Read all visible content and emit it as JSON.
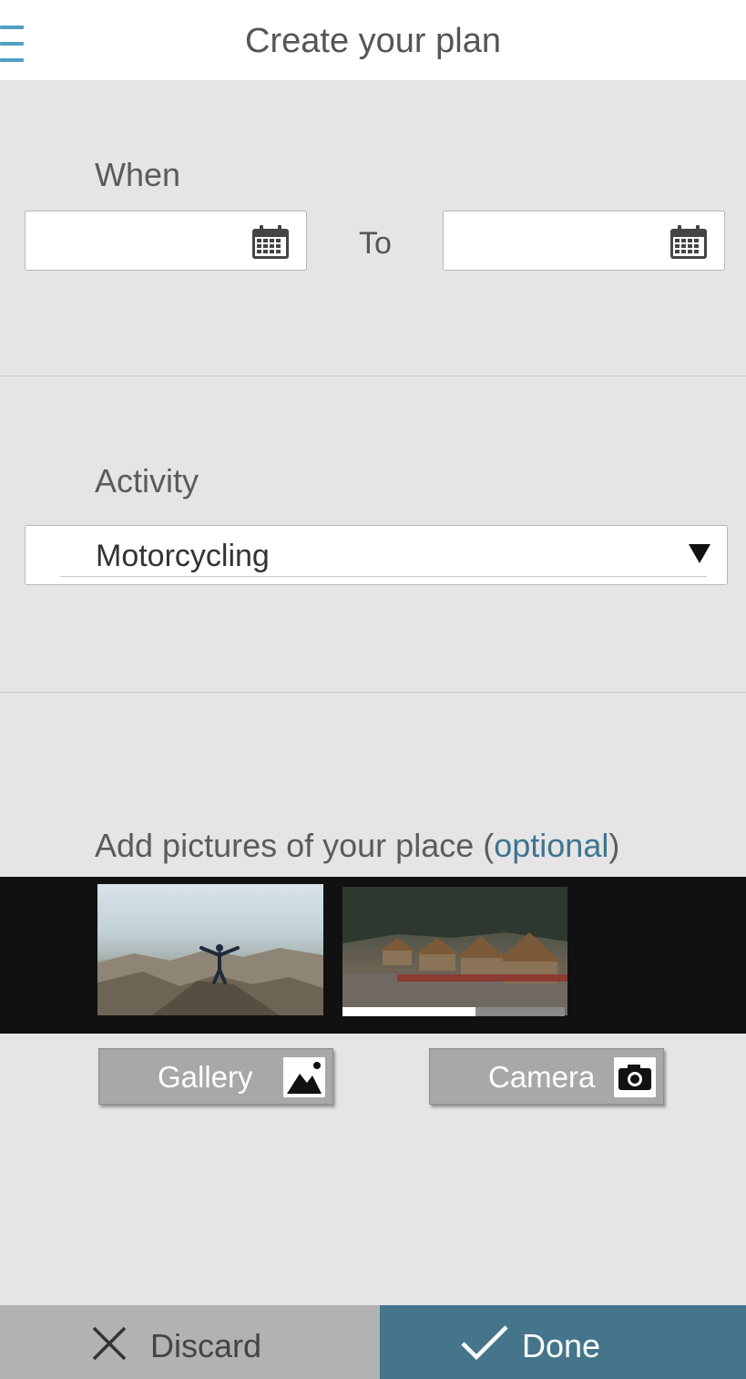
{
  "header": {
    "title": "Create your plan"
  },
  "when": {
    "label": "When",
    "to_label": "To",
    "from_value": "",
    "to_value": ""
  },
  "activity": {
    "label": "Activity",
    "selected": "Motorcycling"
  },
  "pictures": {
    "label_main": "Add pictures of your place (",
    "label_optional": "optional",
    "label_close": ")",
    "upload_progress": 0.6
  },
  "buttons": {
    "gallery": "Gallery",
    "camera": "Camera",
    "discard": "Discard",
    "done": "Done"
  },
  "colors": {
    "accent": "#45758a",
    "optional_text": "#3f7390",
    "menu": "#4fa0c2"
  }
}
